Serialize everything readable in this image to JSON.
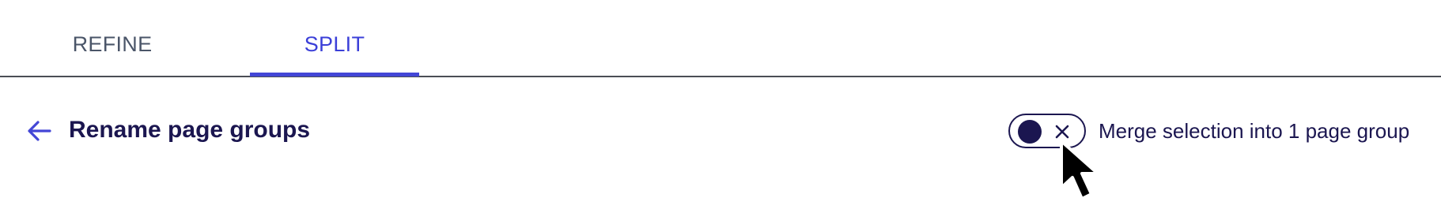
{
  "tabs": [
    {
      "label": "REFINE",
      "active": false
    },
    {
      "label": "SPLIT",
      "active": true
    }
  ],
  "header": {
    "back_icon": "arrow-left-icon",
    "title": "Rename page groups"
  },
  "merge_toggle": {
    "state": "off",
    "icon": "close-icon",
    "label": "Merge selection into 1 page group"
  },
  "colors": {
    "accent": "#4346d6",
    "text_dark": "#1b1650",
    "tab_inactive": "#4a5568",
    "divider": "#4a4d55"
  }
}
